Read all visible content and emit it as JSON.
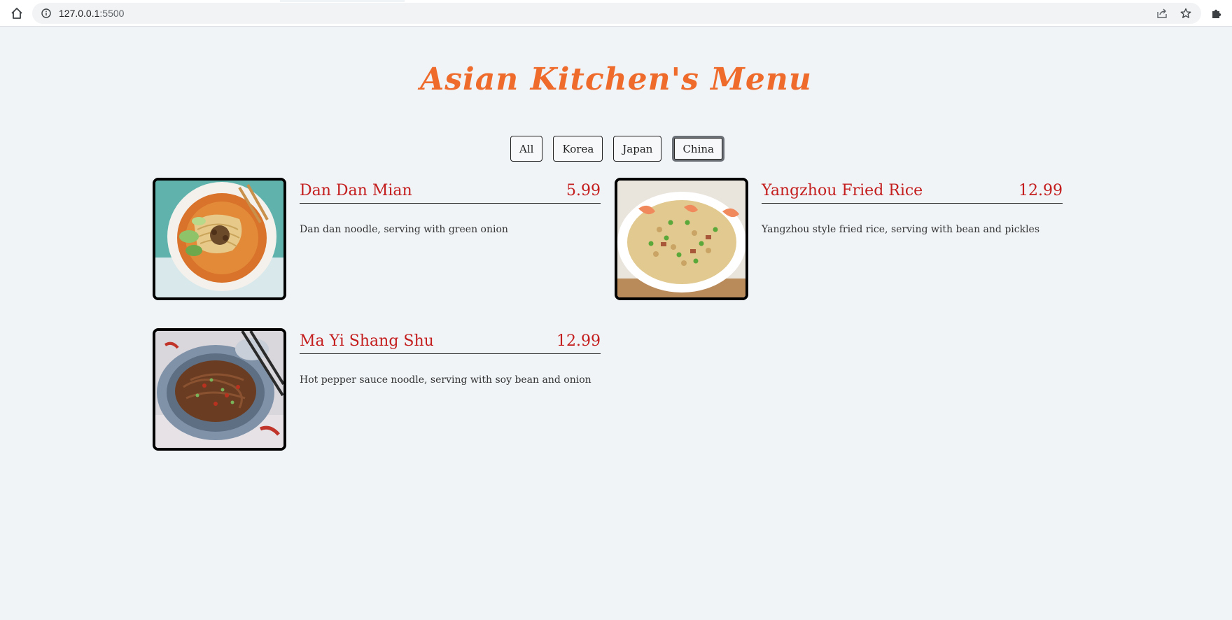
{
  "browser": {
    "url_host": "127.0.0.1",
    "url_port": ":5500"
  },
  "page": {
    "title": "Asian Kitchen's Menu"
  },
  "filters": [
    {
      "label": "All"
    },
    {
      "label": "Korea"
    },
    {
      "label": "Japan"
    },
    {
      "label": "China",
      "active": true
    }
  ],
  "menu": [
    {
      "name": "Dan Dan Mian",
      "price": "5.99",
      "description": "Dan dan noodle, serving with green onion",
      "photo": "dan-dan-noodle-photo"
    },
    {
      "name": "Yangzhou Fried Rice",
      "price": "12.99",
      "description": "Yangzhou style fried rice, serving with bean and pickles",
      "photo": "fried-rice-photo"
    },
    {
      "name": "Ma Yi Shang Shu",
      "price": "12.99",
      "description": "Hot pepper sauce noodle, serving with soy bean and onion",
      "photo": "pepper-noodle-photo"
    }
  ],
  "icons": {
    "home": "home-icon",
    "info": "info-icon",
    "share": "share-icon",
    "bookmark": "star-icon",
    "extensions": "puzzle-icon"
  },
  "colors": {
    "title": "#ef6b2c",
    "dish_text": "#c41d1d",
    "background": "#f0f4f7"
  }
}
